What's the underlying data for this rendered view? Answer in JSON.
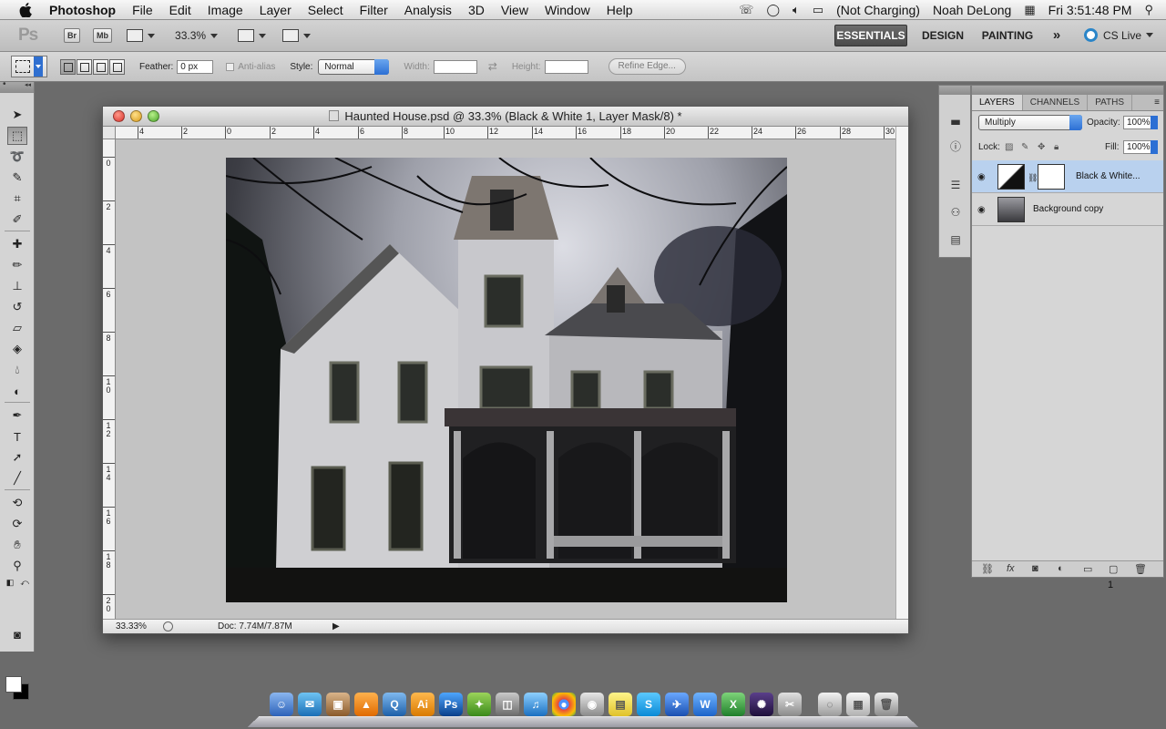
{
  "menubar": {
    "app_name": "Photoshop",
    "items": [
      "File",
      "Edit",
      "Image",
      "Layer",
      "Select",
      "Filter",
      "Analysis",
      "3D",
      "View",
      "Window",
      "Help"
    ],
    "battery_status": "(Not Charging)",
    "user_name": "Noah DeLong",
    "clock": "Fri 3:51:48 PM"
  },
  "appbar": {
    "ps_logo": "Ps",
    "bridge": "Br",
    "minibridge": "Mb",
    "zoom": "33.3%",
    "workspaces": {
      "essentials": "ESSENTIALS",
      "design": "DESIGN",
      "painting": "PAINTING",
      "more": "»"
    },
    "cs_live": "CS Live"
  },
  "options": {
    "feather_label": "Feather:",
    "feather_value": "0 px",
    "antialias_label": "Anti-alias",
    "style_label": "Style:",
    "style_value": "Normal",
    "width_label": "Width:",
    "height_label": "Height:",
    "refine_edge": "Refine Edge..."
  },
  "document": {
    "title": "Haunted House.psd @ 33.3% (Black & White 1, Layer Mask/8) *",
    "ruler_top": [
      "4",
      "2",
      "0",
      "2",
      "4",
      "6",
      "8",
      "10",
      "12",
      "14",
      "16",
      "18",
      "20",
      "22",
      "24",
      "26",
      "28",
      "30"
    ],
    "ruler_left": [
      "0",
      "2",
      "4",
      "6",
      "8",
      "10",
      "12",
      "14",
      "16",
      "18",
      "20"
    ],
    "zoom_status": "33.33%",
    "doc_info": "Doc: 7.74M/7.87M"
  },
  "layers_panel": {
    "tabs": [
      "LAYERS",
      "CHANNELS",
      "PATHS"
    ],
    "blend_mode": "Multiply",
    "opacity_label": "Opacity:",
    "opacity_value": "100%",
    "lock_label": "Lock:",
    "fill_label": "Fill:",
    "fill_value": "100%",
    "layers": [
      {
        "name": "Black & White..."
      },
      {
        "name": "Background copy"
      }
    ],
    "count": "1"
  },
  "colors": {
    "accent_blue": "#2c6fd4",
    "selected_layer": "#b9d1ee",
    "essentials_bg": "#4a4a4a"
  }
}
